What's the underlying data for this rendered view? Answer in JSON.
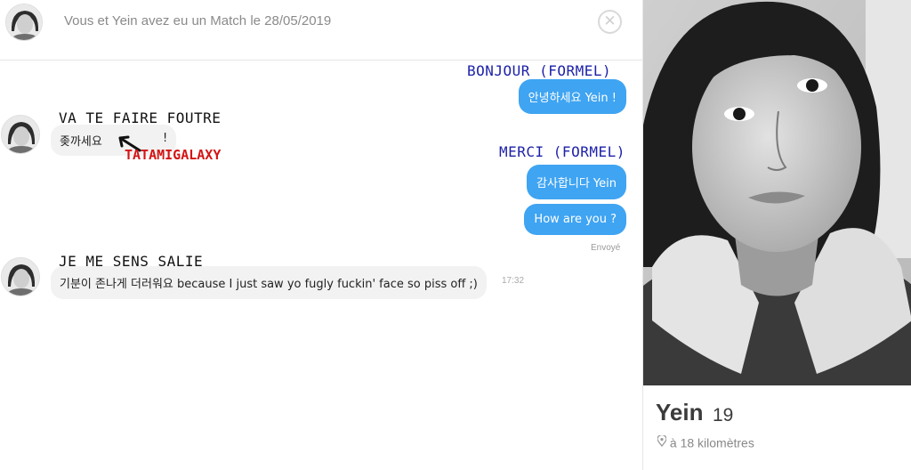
{
  "header": {
    "match_text": "Vous et Yein avez eu un Match le 28/05/2019",
    "close_icon": "close-icon"
  },
  "messages": {
    "m1": {
      "text": "안녕하세요 Yein !",
      "annotation": "BONJOUR (FORMEL)"
    },
    "m2": {
      "text": "좆까세요",
      "trailing": "!",
      "annotation": "VA TE FAIRE FOUTRE",
      "watermark": "TATAMIGALAXY"
    },
    "m3": {
      "text": "감사합니다 Yein",
      "annotation": "MERCI (FORMEL)"
    },
    "m4": {
      "text": "How are you ?",
      "status": "Envoyé"
    },
    "m5": {
      "text": "기분이 존나게 더러워요 because I just saw yo fugly fuckin' face so piss off ;)",
      "annotation": "JE ME SENS SALIE",
      "time": "17:32"
    }
  },
  "profile": {
    "name": "Yein",
    "age": "19",
    "distance": "à 18 kilomètres",
    "location_icon": "location-pin-icon"
  },
  "colors": {
    "outgoing_bubble": "#3fa4f2",
    "incoming_bubble": "#f2f2f2",
    "annotation_blue": "#1d22a8",
    "watermark_red": "#d41414"
  }
}
